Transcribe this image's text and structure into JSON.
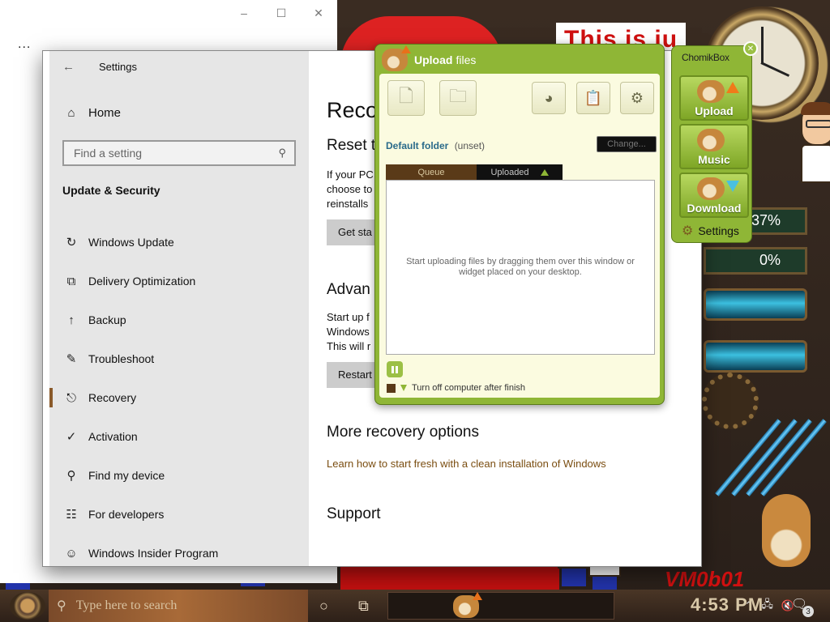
{
  "desktop": {
    "caption_top": "This is ju",
    "caption_bottom": "VM0b01",
    "gauges": [
      {
        "label": "37%",
        "percent": 37
      },
      {
        "label": "0%",
        "percent": 0
      }
    ]
  },
  "background_window": {
    "caption_buttons": [
      "–",
      "☐",
      "✕"
    ],
    "menu_dots": "..."
  },
  "settings": {
    "window_title": "Settings",
    "back_glyph": "←",
    "home_label": "Home",
    "search_placeholder": "Find a setting",
    "section_title": "Update & Security",
    "nav_items": [
      {
        "label": "Windows Update",
        "icon": "↻"
      },
      {
        "label": "Delivery Optimization",
        "icon": "⧉"
      },
      {
        "label": "Backup",
        "icon": "↑"
      },
      {
        "label": "Troubleshoot",
        "icon": "✎"
      },
      {
        "label": "Recovery",
        "icon": "⎋"
      },
      {
        "label": "Activation",
        "icon": "✓"
      },
      {
        "label": "Find my device",
        "icon": "⚲"
      },
      {
        "label": "For developers",
        "icon": "☷"
      },
      {
        "label": "Windows Insider Program",
        "icon": "☺"
      }
    ],
    "content": {
      "page_title": "Reco",
      "reset_heading": "Reset t",
      "reset_text": [
        "If your PC",
        "choose to",
        "reinstalls"
      ],
      "get_started_label": "Get sta",
      "advanced_heading": "Advan",
      "advanced_text": [
        "Start up f",
        "Windows",
        "This will r"
      ],
      "restart_label": "Restart",
      "more_heading": "More recovery options",
      "learn_link": "Learn how to start fresh with a clean installation of Windows",
      "support_heading": "Support"
    }
  },
  "upload_widget": {
    "title_bold": "Upload",
    "title_rest": "files",
    "default_folder_label": "Default folder",
    "default_folder_value": "(unset)",
    "change_label": "Change...",
    "tab_queue": "Queue",
    "tab_uploaded": "Uploaded",
    "drop_hint": "Start uploading files by dragging them over this window or widget placed on your desktop.",
    "shutdown_label": "Turn off computer after finish"
  },
  "chomikbox": {
    "title": "ChomikBox",
    "close_glyph": "✕",
    "upload_label": "Upload",
    "music_label": "Music",
    "download_label": "Download",
    "settings_label": "Settings"
  },
  "taskbar": {
    "search_placeholder": "Type here to search",
    "time": "4:53 PM",
    "notification_count": "3"
  },
  "colors": {
    "widget_green": "#8fb636",
    "accent_brown": "#8a5a2a",
    "link_brown": "#7a4d10",
    "taskbar_brown": "#4a3626"
  }
}
